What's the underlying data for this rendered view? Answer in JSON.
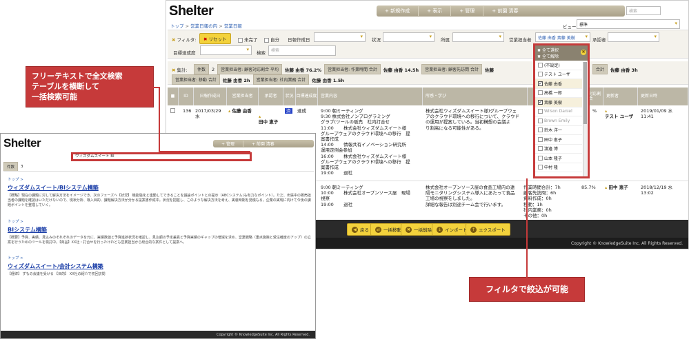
{
  "main": {
    "logo": "Shelter",
    "nav": [
      "新規作成",
      "表示",
      "管理",
      "前園 清春"
    ],
    "search_placeholder": "検索",
    "breadcrumb": [
      "トップ",
      "営業日報の内",
      "営業日報"
    ],
    "view_label": "ビュー",
    "view_value": "標準",
    "filter": {
      "label": "フィルタ:",
      "reset": "リセット",
      "unfinished": "未完了",
      "self": "自分",
      "date_label": "日報作成日",
      "status_label": "状況",
      "dept_label": "所属",
      "owner_label": "営業担当者",
      "owner_value": "佐藤 由香 斎藤 美樹",
      "approver_label": "承認者",
      "progress_label": "目標達成度",
      "search_label": "検索",
      "search_placeholder": "検索"
    },
    "summary": {
      "label": "集計:",
      "items": [
        {
          "tag": "件数",
          "value": "2"
        },
        {
          "tag": "営業担当者: 顧客対応割合 平均",
          "value": "佐藤 由香 76.2%"
        },
        {
          "tag": "営業担当者: 作業時間 合計",
          "value": "佐藤 由香 14.5h"
        },
        {
          "tag": "営業担当者: 顧客先訪問 合計",
          "value": "佐藤"
        },
        {
          "tag": "合計",
          "value": "佐藤 由香 3h"
        },
        {
          "tag": "営業担当者: 移動 合計",
          "value": "佐藤 由香 2h"
        },
        {
          "tag": "営業担当者: 社内業務 合計",
          "value": "佐藤 由香 1.5h"
        }
      ]
    },
    "columns": [
      "ID",
      "日報作成日",
      "営業担当者",
      "承認者",
      "状況",
      "目標達成度",
      "営業内容",
      "所感・学び",
      "顧客対応割合",
      "更新者",
      "更新日時"
    ],
    "rows": [
      {
        "id": "136",
        "date": "2017/03/29\n水",
        "owner": "佐藤 由香",
        "approver": "田中 恵子",
        "status": "済",
        "progress": "達成",
        "content": "9:00\t朝ミーティング\n9:30\t株式会社ノンプログラミング\nグラブ(ツールの販売　社内打合せ\n11:00\t株式会社ウィズダムスイート様\nグループウェアのクラウド環境への移行　提\n案書作成\n14:00\t情報共有イノベーション研究所\n運用定例会参加\n16:00\t株式会社ウィズダムスイート様\nグループウェアのクラウド環境への移行　提\n案書作成\n19:00\t退社",
        "note": "株式会社ウィズダムスイート様)グループウェ\nアのクラウド環境への移行について、クラウド\nの運用が提案している。当初構想の会議よ\nり割高になる可能性がある。",
        "ratio": "%",
        "updater": "テスト ユーザ",
        "updated": "2019/01/09 水\n11:41"
      },
      {
        "id": "",
        "date": "",
        "owner": "",
        "approver": "",
        "status": "",
        "progress": "",
        "content": "9:00\t朝ミーティング\n10:00\t株式会社オープンソース屋　現場\n視察\n19:00\t退社",
        "note": "株式会社オープンソース屋の食品工場内の遠\n隔モニタリングシステム導入にあたって食品\n工場の視察をしました。\n詳細な報告は別途チーム会で行います。",
        "work": "作業時間合計：7h\n顧客先訪問：6h\n資料作成：0h\n移動：1h\n社内業務：0h\nその他：0h",
        "ratio": "85.7%",
        "updater": "田中 恵子",
        "updated": "2018/12/19 水\n13:02"
      }
    ],
    "bottom_buttons": [
      "戻る",
      "一括移動",
      "一括削除",
      "インポート",
      "エクスポート"
    ],
    "footer": "Copyright © KnowledgeSuite Inc. All Rights Reserved."
  },
  "dropdown": {
    "header": [
      "全て選択",
      "全て解除"
    ],
    "items": [
      {
        "label": "(不設定)",
        "checked": false
      },
      {
        "label": "テスト ユーザ",
        "checked": false
      },
      {
        "label": "佐藤 由香",
        "checked": true
      },
      {
        "label": "高橋 一郎",
        "checked": false
      },
      {
        "label": "斎藤 美樹",
        "checked": true
      },
      {
        "label": "Wilson Daniel",
        "checked": false
      },
      {
        "label": "Brown Emily",
        "checked": false
      },
      {
        "label": "鈴木 洋一",
        "checked": false
      },
      {
        "label": "田中 恵子",
        "checked": false
      },
      {
        "label": "渡邊 博",
        "checked": false
      },
      {
        "label": "山本 隆子",
        "checked": false
      },
      {
        "label": "中村 隆",
        "checked": false
      }
    ]
  },
  "search_shot": {
    "logo": "Shelter",
    "nav": [
      "管理",
      "前園 清春"
    ],
    "query": "ウィズダムスイート BI",
    "count_label": "件数",
    "count": "3",
    "results": [
      {
        "crumb": "トップ >",
        "title": "ウィズダムスイート/BIシステム構築",
        "body": "【概略】現在の課題に対して解決方法をイメージでき、次のフェーズへ【状況】 機能強化と連動してできることを議論ポイントとの提示（ABCシステム)も有力なポイント）。ただ、出張中の販売担当者の課題を確認はいただけないので、現状分析、導入目的、課題解決方法が分かる提案書作成中。状況を把握し、このような解決方法を考え、実装時期を見積もる。企業の実現に向けて今後の課題ポイントを整理していく。"
      },
      {
        "crumb": "トップ >",
        "title": "BIシステム構築",
        "body": "【概要】予算、実績、見込みのそれぞれのデータを元に、実績数値と予算進捗状況を確認し、見込額の予定差異と予算実績のギャップの増減を求め、営業戦略（重点施策と受注確度のアップ）の立案を行うためのツールを検討中。【商品】XX社・打合せを行ったけれども営業担当から総合的な案件として提案へ。"
      },
      {
        "crumb": "トップ >",
        "title": "ウィズダムスイート/会計システム構築",
        "body": "【経緯】 ずもの会議を受ける 【目的】 XX社の紹介で初回訪問"
      }
    ],
    "footer": "Copyright © KnowledgeSuite Inc. All Rights Reserved."
  },
  "callouts": {
    "search": "フリーテキストで全文検索\nテーブルを横断して\n一括検索可能",
    "filter": "フィルタで絞込が可能"
  },
  "colors": {
    "accent": "#c63a3a",
    "yellow": "#f3d23c",
    "nav": "#b3ab94"
  }
}
